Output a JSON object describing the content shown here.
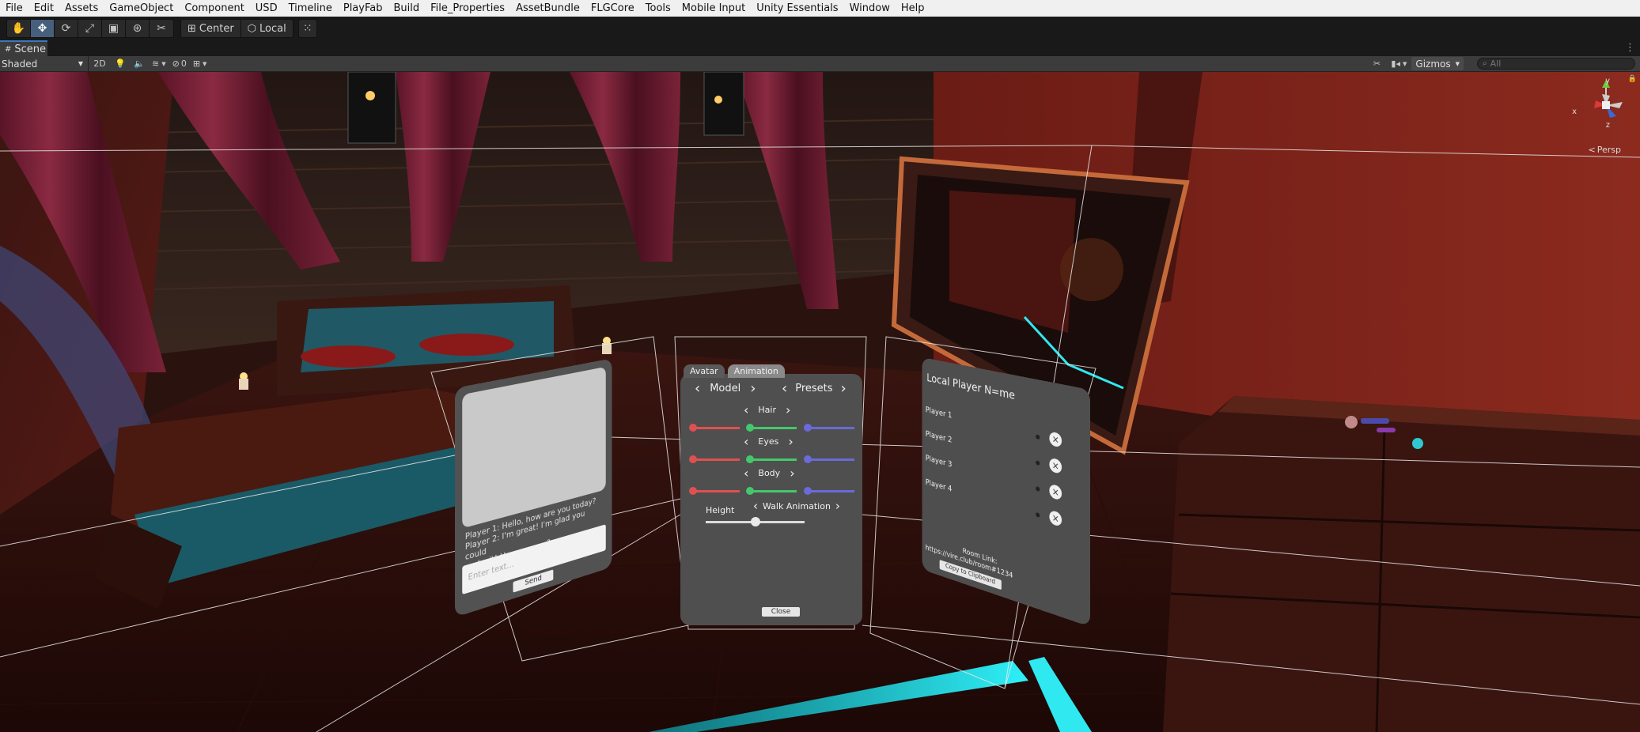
{
  "menu": [
    "File",
    "Edit",
    "Assets",
    "GameObject",
    "Component",
    "USD",
    "Timeline",
    "PlayFab",
    "Build",
    "File_Properties",
    "AssetBundle",
    "FLGCore",
    "Tools",
    "Mobile Input",
    "Unity Essentials",
    "Window",
    "Help"
  ],
  "toolbar": {
    "tools": [
      "hand-tool",
      "move-tool",
      "rotate-tool",
      "scale-tool",
      "rect-tool",
      "transform-tool",
      "custom-tool"
    ],
    "pivot_label": "Center",
    "space_label": "Local"
  },
  "scene_tab": {
    "label": "Scene",
    "menu_glyph": "⋮"
  },
  "scene_bar": {
    "shading_mode": "Shaded",
    "mode_2d": "2D",
    "hidden_count": "0",
    "gizmos_label": "Gizmos",
    "search_placeholder": "All"
  },
  "orientation": {
    "x_label": "x",
    "y_label": "y",
    "z_label": "z",
    "projection": "Persp",
    "projection_glyph": "<"
  },
  "chat_panel": {
    "messages": [
      "Player 1: Hello, how are you today?",
      "Player 2: I'm great! I'm glad you could",
      "make it! How are you?"
    ],
    "input_placeholder": "Enter text...",
    "send_label": "Send"
  },
  "avatar_panel": {
    "tabs": [
      "Avatar",
      "Animation"
    ],
    "model_label": "Model",
    "presets_label": "Presets",
    "hair_label": "Hair",
    "eyes_label": "Eyes",
    "body_label": "Body",
    "walk_label": "Walk Animation",
    "height_label": "Height",
    "height_value": 0.5,
    "close_label": "Close"
  },
  "players_panel": {
    "title": "Local Player N=me",
    "players": [
      "Player 1",
      "Player 2",
      "Player 3",
      "Player 4"
    ],
    "kick_glyph": "×",
    "room_link_label": "Room Link:",
    "room_link_url": "https://vire.club/room#1234",
    "copy_label": "Copy to Clipboard"
  },
  "colors": {
    "accent": "#46607c",
    "red_slider": "#e05050",
    "green_slider": "#44c86a",
    "blue_slider": "#6a6ad8",
    "cyan_beam": "#22e5ee"
  }
}
